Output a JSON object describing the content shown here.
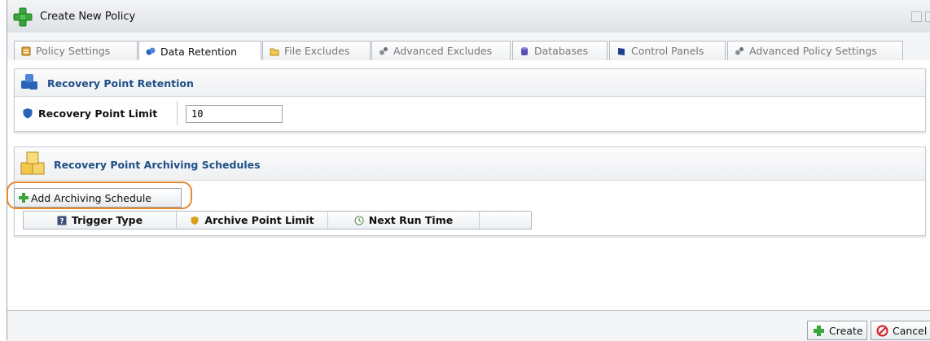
{
  "window": {
    "title": "Create New Policy"
  },
  "tabs": [
    {
      "label": "Policy Settings",
      "icon": "policy-settings-icon",
      "active": false
    },
    {
      "label": "Data Retention",
      "icon": "data-retention-icon",
      "active": true
    },
    {
      "label": "File Excludes",
      "icon": "folder-icon",
      "active": false
    },
    {
      "label": "Advanced Excludes",
      "icon": "gears-icon",
      "active": false
    },
    {
      "label": "Databases",
      "icon": "database-icon",
      "active": false
    },
    {
      "label": "Control Panels",
      "icon": "control-panel-icon",
      "active": false
    },
    {
      "label": "Advanced Policy Settings",
      "icon": "gears-icon",
      "active": false
    }
  ],
  "retention": {
    "title": "Recovery Point Retention",
    "limit_label": "Recovery Point Limit",
    "limit_value": "10"
  },
  "archiving": {
    "title": "Recovery Point Archiving Schedules",
    "add_button": "Add Archiving Schedule",
    "columns": [
      "Trigger Type",
      "Archive Point Limit",
      "Next Run Time"
    ]
  },
  "footer": {
    "create": "Create",
    "cancel": "Cancel"
  },
  "colors": {
    "accent": "#1f4f86",
    "highlight": "#e8892d",
    "green": "#3aa53a",
    "red": "#d22222"
  }
}
